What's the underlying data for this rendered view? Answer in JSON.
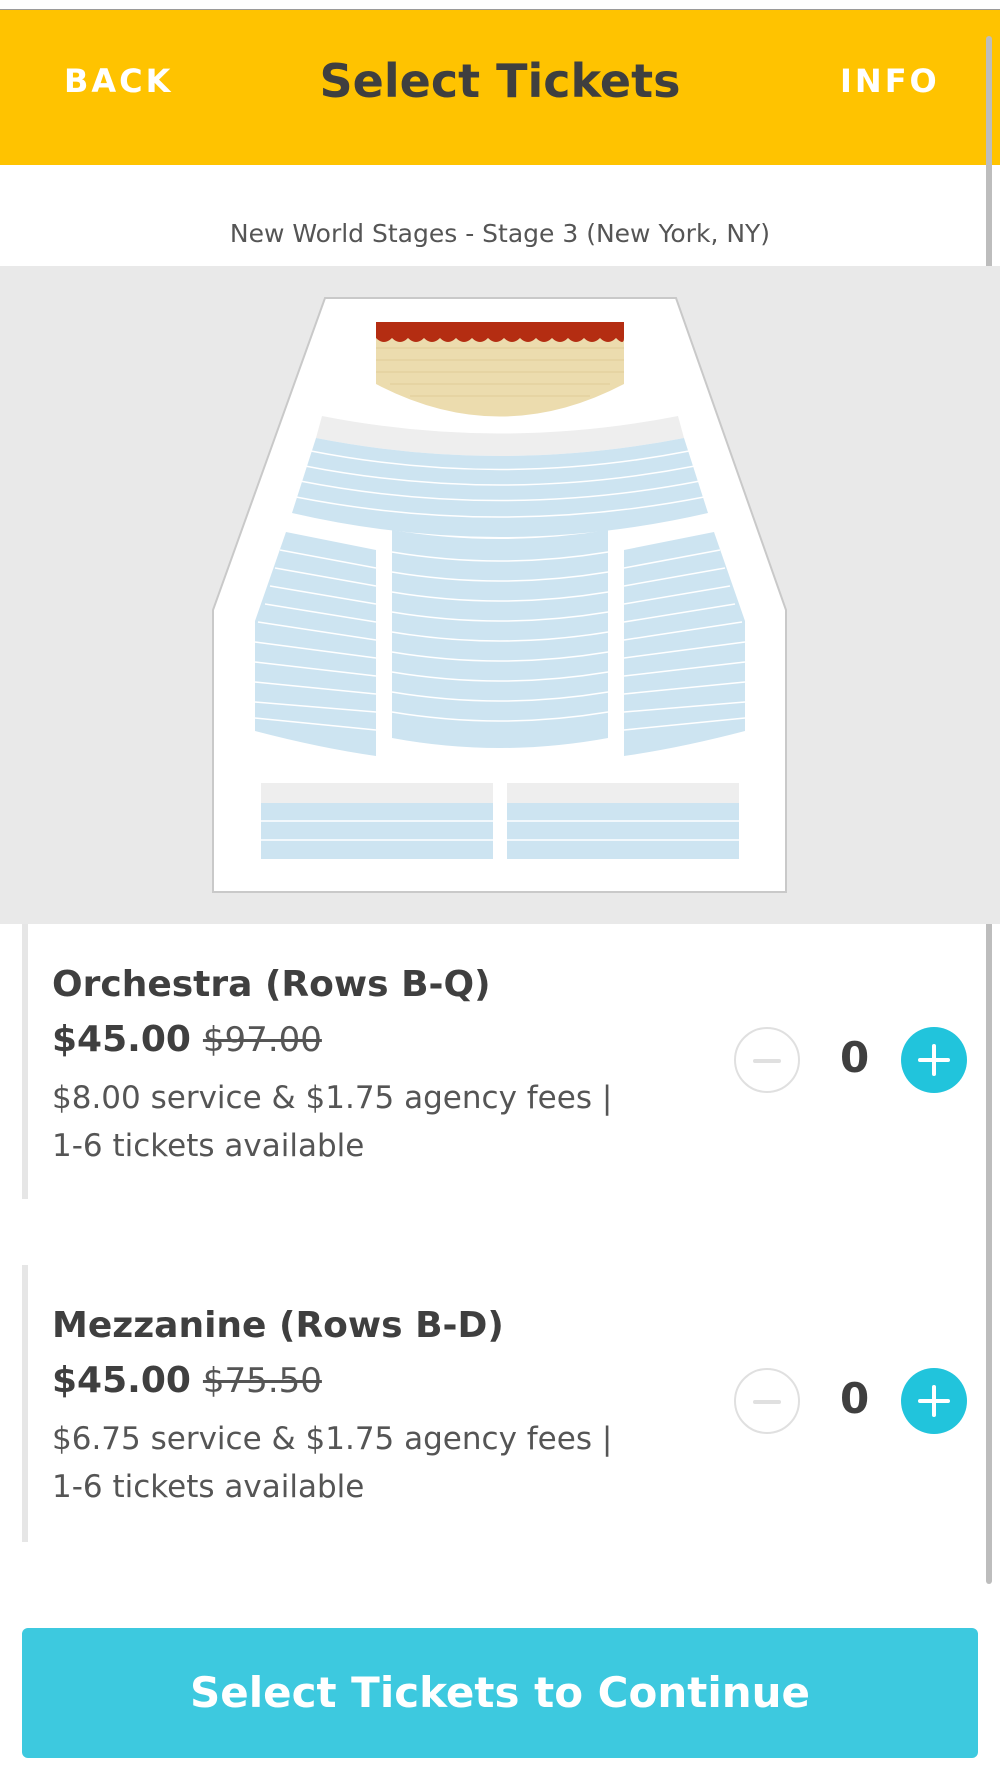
{
  "header": {
    "back_label": "BACK",
    "title": "Select Tickets",
    "info_label": "INFO",
    "bg_color": "#FFC300"
  },
  "venue": "New World Stages - Stage 3 (New York, NY)",
  "tickets": [
    {
      "section": "Orchestra (Rows B-Q)",
      "price": "$45.00",
      "original_price": "$97.00",
      "fees": "$8.00 service & $1.75 agency fees | 1-6 tickets available",
      "quantity": "0"
    },
    {
      "section": "Mezzanine (Rows B-D)",
      "price": "$45.00",
      "original_price": "$75.50",
      "fees": "$6.75 service & $1.75 agency fees | 1-6 tickets available",
      "quantity": "0"
    }
  ],
  "cta_label": "Select Tickets to Continue",
  "accent_color": "#21C4DC",
  "icons": [
    "minus-icon",
    "plus-icon"
  ]
}
